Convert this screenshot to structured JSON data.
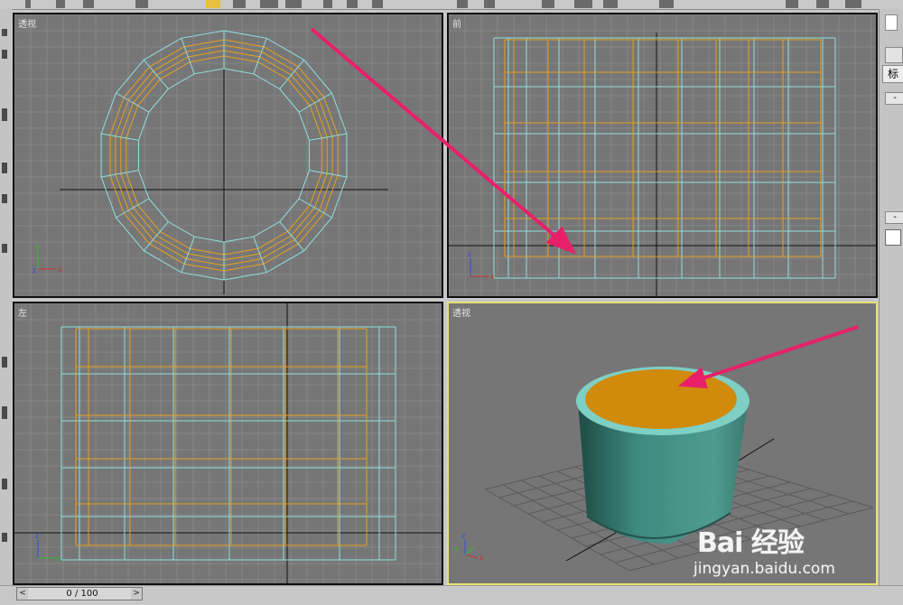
{
  "viewports": {
    "top": {
      "label": "透视"
    },
    "front": {
      "label": "前"
    },
    "left": {
      "label": "左"
    },
    "perspective": {
      "label": "透视"
    }
  },
  "axes": {
    "x": "x",
    "y": "y",
    "z": "z"
  },
  "timeslider": {
    "frame_text": "0 / 100",
    "prev_icon": "chevron-left-icon",
    "next_icon": "chevron-right-icon"
  },
  "right_panel": {
    "tab_label": "标",
    "rollout_minus_1": "-",
    "rollout_minus_2": "-"
  },
  "watermark": {
    "logo": "Bai 经验",
    "url": "jingyan.baidu.com"
  },
  "colors": {
    "viewport_bg": "#767676",
    "wire_cyan": "#8fe0e0",
    "wire_orange": "#e8a020",
    "active_border": "#e8e070",
    "annotation_arrow": "#e8206a",
    "cylinder_body": "#3f8a80",
    "cylinder_top": "#d08a0c"
  }
}
